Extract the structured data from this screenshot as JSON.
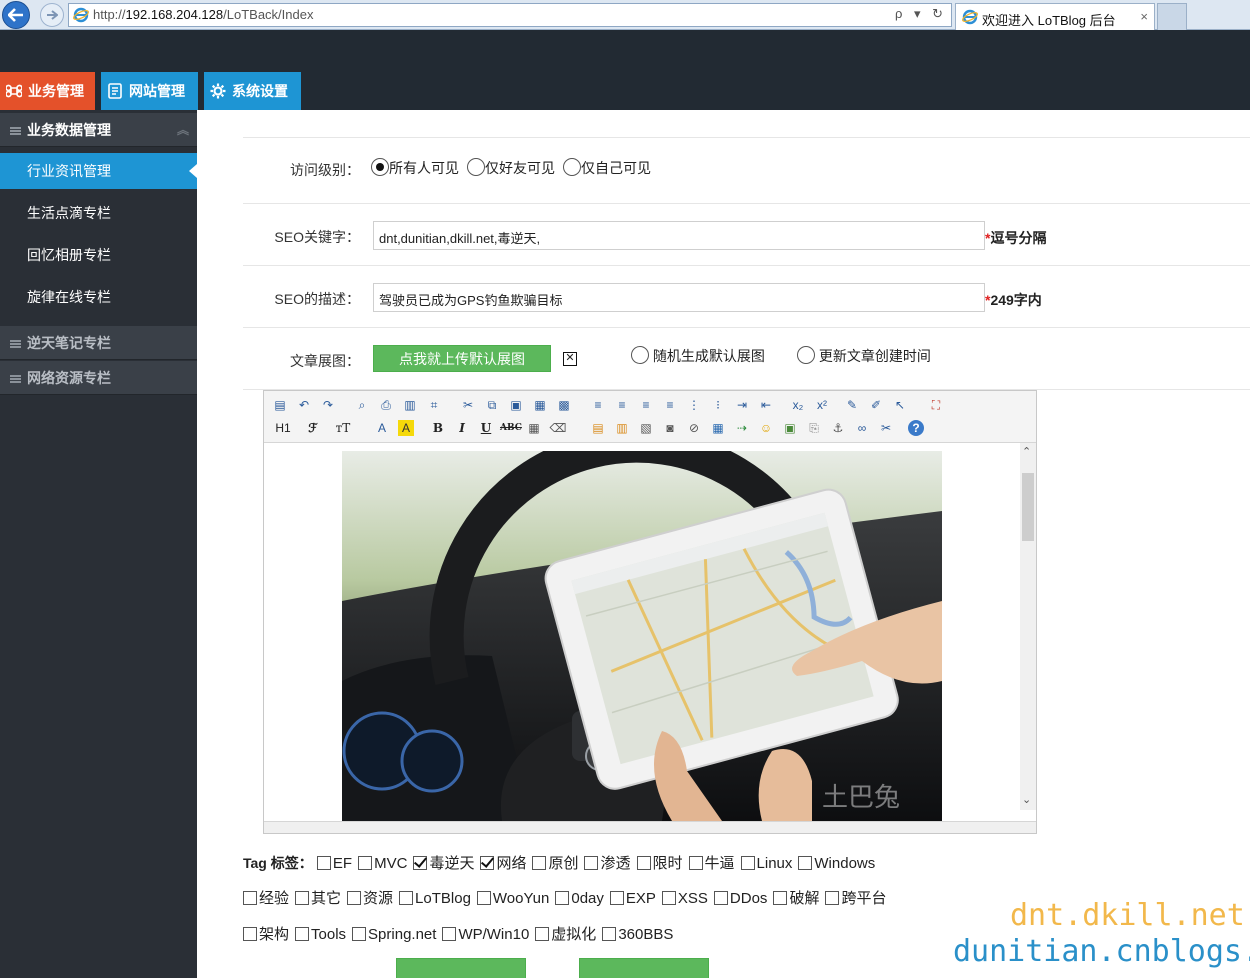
{
  "browser": {
    "url_prefix": "http://",
    "url_host": "192.168.204.128",
    "url_path": "/LoTBack/Index",
    "address_tools": "ρ ▾ ↻",
    "tab_title": "欢迎进入 LoTBlog 后台",
    "tab_close": "×"
  },
  "top_nav": {
    "tabs": [
      {
        "label": "业务管理",
        "icon": "command-icon",
        "color": "#e4512a"
      },
      {
        "label": "网站管理",
        "icon": "document-icon",
        "color": "#1e95d4"
      },
      {
        "label": "系统设置",
        "icon": "gear-icon",
        "color": "#1e95d4"
      }
    ]
  },
  "sidebar": {
    "group_active": "业务数据管理",
    "items": [
      "行业资讯管理",
      "生活点滴专栏",
      "回忆相册专栏",
      "旋律在线专栏"
    ],
    "groups": [
      "逆天笔记专栏",
      "网络资源专栏"
    ]
  },
  "form": {
    "cut_off_row": "",
    "visibility": {
      "label": "访问级别：",
      "options": [
        "所有人可见",
        "仅好友可见",
        "仅自己可见"
      ],
      "selected": "所有人可见"
    },
    "seo_keywords": {
      "label": "SEO关键字：",
      "value": "dnt,dunitian,dkill.net,毒逆天,",
      "star": "*",
      "hint": "逗号分隔"
    },
    "seo_desc": {
      "label": "SEO的描述：",
      "value": "驾驶员已成为GPS钓鱼欺骗目标",
      "star": "*",
      "hint": "249字内"
    },
    "cover": {
      "label": "文章展图：",
      "upload_label": "点我就上传默认展图",
      "x_mark": "✕",
      "opt_random": "随机生成默认展图",
      "opt_update": "更新文章创建时间"
    }
  },
  "editor": {
    "row1": [
      "source-icon",
      "undo-icon",
      "redo-icon",
      "preview-icon",
      "print-icon",
      "template-icon",
      "code-icon",
      "cut-icon",
      "copy-icon",
      "paste-icon",
      "paste-text-icon",
      "paste-word-icon",
      "align-left-icon",
      "align-center-icon",
      "align-right-icon",
      "justify-icon",
      "ordered-list-icon",
      "unordered-list-icon",
      "indent-icon",
      "outdent-icon",
      "subscript-icon",
      "superscript-icon",
      "clear-format-icon",
      "select-all-icon",
      "cursor-icon",
      "fullscreen-icon"
    ],
    "row2_text": {
      "h1": "H1",
      "font": "ℱ",
      "size": "тT",
      "fore": "A",
      "back": "A",
      "bold": "B",
      "italic": "I",
      "underline": "U",
      "strike": "ABC"
    }
  },
  "tags": {
    "title": "Tag 标签：",
    "line1": [
      {
        "label": "EF",
        "checked": false
      },
      {
        "label": "MVC",
        "checked": false
      },
      {
        "label": "毒逆天",
        "checked": true
      },
      {
        "label": "网络",
        "checked": true
      },
      {
        "label": "原创",
        "checked": false
      },
      {
        "label": "渗透",
        "checked": false
      },
      {
        "label": "限时",
        "checked": false
      },
      {
        "label": "牛逼",
        "checked": false
      },
      {
        "label": "Linux",
        "checked": false
      },
      {
        "label": "Windows",
        "checked": false
      }
    ],
    "line2": [
      {
        "label": "经验",
        "checked": false
      },
      {
        "label": "其它",
        "checked": false
      },
      {
        "label": "资源",
        "checked": false
      },
      {
        "label": "LoTBlog",
        "checked": false
      },
      {
        "label": "WooYun",
        "checked": false
      },
      {
        "label": "0day",
        "checked": false
      },
      {
        "label": "EXP",
        "checked": false
      },
      {
        "label": "XSS",
        "checked": false
      },
      {
        "label": "DDos",
        "checked": false
      },
      {
        "label": "破解",
        "checked": false
      },
      {
        "label": "跨平台",
        "checked": false
      }
    ],
    "line3": [
      {
        "label": "架构",
        "checked": false
      },
      {
        "label": "Tools",
        "checked": false
      },
      {
        "label": "Spring.net",
        "checked": false
      },
      {
        "label": "WP/Win10",
        "checked": false
      },
      {
        "label": "虚拟化",
        "checked": false
      },
      {
        "label": "360BBS",
        "checked": false
      }
    ]
  },
  "watermark": {
    "line1": "dnt.dkill.net",
    "line2": "dunitian.cnblogs.com"
  },
  "colors": {
    "accent_orange": "#e4512a",
    "accent_blue": "#1e95d4",
    "success_green": "#5cb85c",
    "sidebar_bg": "#2a2f36"
  }
}
